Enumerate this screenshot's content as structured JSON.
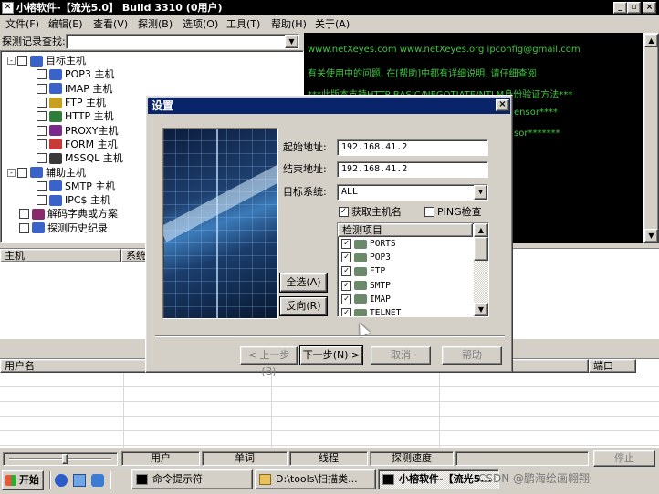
{
  "window": {
    "title": "小榕软件-【流光5.0】 Build 3310 (0用户)"
  },
  "menu": [
    "文件(F)",
    "编辑(E)",
    "查看(V)",
    "探测(B)",
    "选项(O)",
    "工具(T)",
    "帮助(H)",
    "关于(A)"
  ],
  "search": {
    "label": "探测记录查找:",
    "value": ""
  },
  "tree": [
    {
      "label": "目标主机",
      "level": 0,
      "expand": "-",
      "icon": "target-hosts-icon",
      "color": "#3a62c8"
    },
    {
      "label": "POP3 主机",
      "level": 1,
      "icon": "pop3-icon",
      "color": "#3a62c8"
    },
    {
      "label": "IMAP 主机",
      "level": 1,
      "icon": "imap-icon",
      "color": "#3a62c8"
    },
    {
      "label": "FTP  主机",
      "level": 1,
      "icon": "ftp-icon",
      "color": "#c8a020"
    },
    {
      "label": "HTTP 主机",
      "level": 1,
      "icon": "http-icon",
      "color": "#2f7d3a"
    },
    {
      "label": "PROXY主机",
      "level": 1,
      "icon": "proxy-icon",
      "color": "#7a2a8a"
    },
    {
      "label": "FORM 主机",
      "level": 1,
      "icon": "form-icon",
      "color": "#c83a3a"
    },
    {
      "label": "MSSQL 主机",
      "level": 1,
      "icon": "mssql-icon",
      "color": "#3a3a3a"
    },
    {
      "label": "辅助主机",
      "level": 0,
      "expand": "-",
      "icon": "aux-hosts-icon",
      "color": "#3a62c8"
    },
    {
      "label": "SMTP 主机",
      "level": 1,
      "icon": "smtp-icon",
      "color": "#3a62c8"
    },
    {
      "label": "IPC$ 主机",
      "level": 1,
      "icon": "ipc-icon",
      "color": "#3a62c8"
    },
    {
      "label": "解码字典或方案",
      "level": 0,
      "icon": "dictionary-icon",
      "color": "#8a2a6a"
    },
    {
      "label": "探测历史纪录",
      "level": 0,
      "icon": "history-icon",
      "color": "#3a62c8"
    }
  ],
  "log": [
    {
      "text": "www.netXeyes.com www.netXeyes.org ipconfig@gmail.com"
    },
    {
      "text": "有关使用中的问题, 在[帮助]中都有详细说明, 请仔细查阅"
    },
    {
      "text": "***此版本支持HTTP BASIC/NEGOTIATE/NTLM身份验证方法***"
    },
    {
      "text": "ensor****"
    },
    {
      "text": "sor*******"
    }
  ],
  "grid_top": {
    "columns": [
      "主机",
      "系统"
    ]
  },
  "grid_bottom": {
    "columns": [
      "用户名",
      "端口"
    ]
  },
  "status": {
    "slider": 0.55,
    "cells": [
      "用户",
      "单词",
      "线程",
      "探测速度"
    ],
    "stop": "停止"
  },
  "dialog": {
    "title": "设置",
    "start_label": "起始地址:",
    "start_value": "192.168.41.2",
    "end_label": "结束地址:",
    "end_value": "192.168.41.2",
    "system_label": "目标系统:",
    "system_value": "ALL",
    "gethost_label": "获取主机名",
    "gethost_checked": true,
    "ping_label": "PING检查",
    "ping_checked": false,
    "list_header": "检测项目",
    "items": [
      "PORTS",
      "POP3",
      "FTP",
      "SMTP",
      "IMAP",
      "TELNET"
    ],
    "select_all": "全选(A)",
    "invert": "反向(R)",
    "prev": "< 上一步(B)",
    "next": "下一步(N) >",
    "cancel": "取消",
    "help": "帮助"
  },
  "taskbar": {
    "start": "开始",
    "tasks": [
      "命令提示符",
      "D:\\tools\\扫描类...",
      "小榕软件-【流光5..."
    ],
    "watermark": "CSDN @鹏海绘画翱翔",
    "clock": ""
  }
}
